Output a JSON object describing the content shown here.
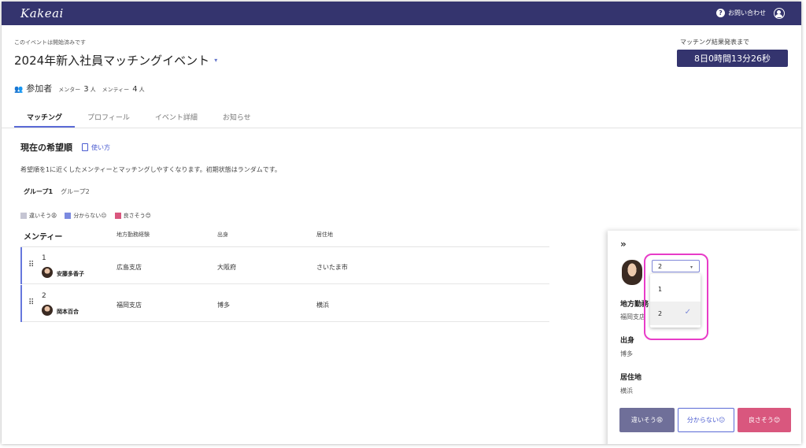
{
  "header": {
    "logo": "Kakeai",
    "help_icon_text": "?",
    "help_label": "お問い合わせ"
  },
  "event": {
    "notice": "このイベントは開始済みです",
    "title": "2024年新入社員マッチングイベント",
    "caret": "▾",
    "countdown_label": "マッチング結果発表まで",
    "countdown": "8日0時間13分26秒"
  },
  "participants": {
    "icon": "👥",
    "label": "参加者",
    "mentor_label": "メンター",
    "mentor_count": "3",
    "mentee_label": "メンティー",
    "mentee_count": "4",
    "unit": "人"
  },
  "tabs": [
    {
      "label": "マッチング"
    },
    {
      "label": "プロフィール"
    },
    {
      "label": "イベント詳細"
    },
    {
      "label": "お知らせ"
    }
  ],
  "section": {
    "title": "現在の希望順",
    "howto": "使い方",
    "description": "希望順を1に近くしたメンティーとマッチングしやすくなります。初期状態はランダムです。"
  },
  "groups": [
    {
      "label": "グループ1"
    },
    {
      "label": "グループ2"
    }
  ],
  "legend": [
    {
      "label": "違いそう😩",
      "color": "#c5c5d3"
    },
    {
      "label": "分からない😐",
      "color": "#7b8ae0"
    },
    {
      "label": "良さそう😊",
      "color": "#d9577e"
    }
  ],
  "table": {
    "headers": [
      "メンティー",
      "地方勤務経験",
      "出身",
      "居住地"
    ],
    "handle": "⠿",
    "rows": [
      {
        "rank": "1",
        "name": "安藤多香子",
        "branch": "広島支店",
        "origin": "大阪府",
        "residence": "さいたま市"
      },
      {
        "rank": "2",
        "name": "岡本百合",
        "branch": "福岡支店",
        "origin": "博多",
        "residence": "横浜"
      }
    ]
  },
  "panel": {
    "expand": "»",
    "select_value": "2",
    "select_arrow": "▾",
    "options": [
      {
        "label": "1"
      },
      {
        "label": "2",
        "check": "✓"
      }
    ],
    "field1_label": "地方勤務",
    "field1_value": "福岡支店",
    "field2_label": "出身",
    "field2_value": "博多",
    "field3_label": "居住地",
    "field3_value": "横浜",
    "btn_bad": "違いそう😩",
    "btn_unknown": "分からない😐",
    "btn_good": "良さそう😊"
  },
  "colors": {
    "header_bg": "#34346e",
    "accent": "#5a6ad6",
    "highlight": "#e83cc8"
  }
}
